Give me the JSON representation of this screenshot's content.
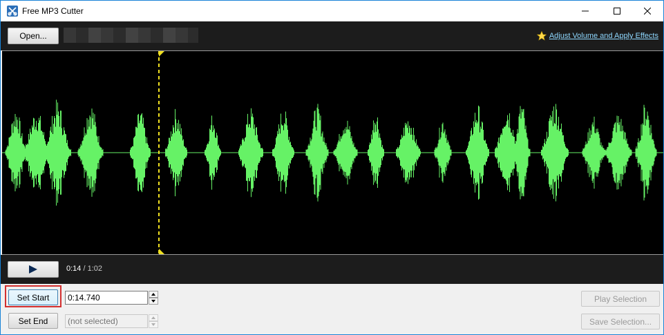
{
  "window": {
    "title": "Free MP3 Cutter"
  },
  "toolbar": {
    "open_label": "Open...",
    "adjust_link": "Adjust Volume and Apply Effects"
  },
  "playback": {
    "current": "0:14",
    "total": "/ 1:02"
  },
  "controls": {
    "set_start_label": "Set Start",
    "start_value": "0:14.740",
    "set_end_label": "Set End",
    "end_placeholder": "(not selected)",
    "play_selection_label": "Play Selection",
    "save_selection_label": "Save Selection..."
  },
  "colors": {
    "waveform": "#66f266",
    "marker": "#f0e020",
    "link": "#8fd8ff",
    "highlight": "#d32f2f"
  },
  "icons": {
    "app": "scissors-icon",
    "adjust": "star-icon",
    "play": "play-icon"
  }
}
